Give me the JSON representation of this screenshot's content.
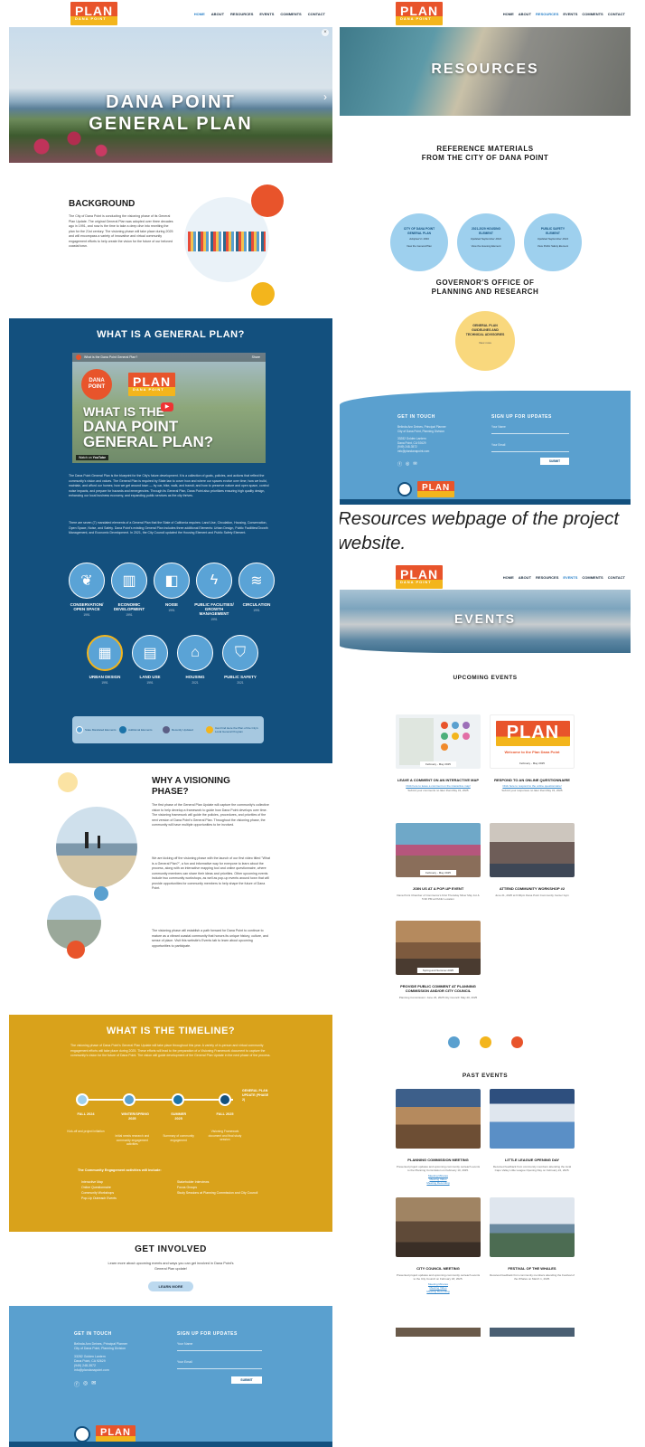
{
  "home": {
    "logo": {
      "main": "PLAN",
      "sub": "DANA POINT"
    },
    "nav": [
      "HOME",
      "ABOUT",
      "RESOURCES",
      "EVENTS",
      "COMMENTS",
      "CONTACT"
    ],
    "hero_line1": "DANA POINT",
    "hero_line2": "GENERAL PLAN",
    "background": {
      "title": "BACKGROUND",
      "body": "The City of Dana Point is conducting the visioning phase of its General Plan Update. The original General Plan was adopted over three decades ago in 1991, and now is the time to take a deep dive into rewriting the plan for the 21st century. The visioning phase will take place during 2025 and will encompass a variety of innovative and virtual community engagement efforts to help create the vision for the future of our beloved coastal town."
    },
    "general_plan": {
      "title": "WHAT IS A GENERAL PLAN?",
      "video_title": "What is the Dana Point General Plan?",
      "video_line1": "WHAT IS THE",
      "video_line2": "DANA POINT",
      "video_line3": "GENERAL PLAN?",
      "video_badge": "DANA POINT",
      "watch_on": "Watch on",
      "youtube": "YouTube",
      "share": "Share",
      "para1": "The Dana Point General Plan is the blueprint for the City's future development. It is a collection of goals, policies, and actions that reflect the community's vision and values. The General Plan is required by State law to cover how and where our spaces evolve over time; how we build, maintain, and afford our homes; how we get around town — by car, bike, walk, and transit; and how to preserve nature and open space, control noise impacts, and prepare for hazards and emergencies. Through its General Plan, Dana Point also prioritizes ensuring high quality design, enhancing our local business economy, and expanding public services as the city thrives.",
      "para2": "There are seven (7) mandated elements of a General Plan that the State of California requires: Land Use, Circulation, Housing, Conservation, Open Space, Noise, and Safety. Dana Point's existing General Plan includes three additional Elements: Urban Design, Public Facilities/Growth Management, and Economic Development. In 2021, the City Council updated the Housing Element and Public Safety Element.",
      "elements_row1": [
        {
          "label": "CONSERVATION/ OPEN SPACE",
          "year": "1991",
          "icon": "leaf-icon"
        },
        {
          "label": "ECONOMIC DEVELOPMENT",
          "year": "1991",
          "icon": "bar-chart-icon"
        },
        {
          "label": "NOISE",
          "year": "1991",
          "icon": "speaker-icon"
        },
        {
          "label": "PUBLIC FACILITIES/ GROWTH MANAGEMENT",
          "year": "1991",
          "icon": "lightning-icon"
        },
        {
          "label": "CIRCULATION",
          "year": "1991",
          "icon": "waves-icon"
        }
      ],
      "elements_row2": [
        {
          "label": "URBAN DESIGN",
          "year": "1991",
          "icon": "building-icon"
        },
        {
          "label": "LAND USE",
          "year": "1991",
          "icon": "grid-icon"
        },
        {
          "label": "HOUSING",
          "year": "2021",
          "icon": "house-icon"
        },
        {
          "label": "PUBLIC SAFETY",
          "year": "2021",
          "icon": "shield-icon"
        }
      ],
      "legend": [
        "State Mandated Elements",
        "Additional Elements",
        "Recently Updated",
        "Can Find Here the Plan of the City's Local General Program"
      ]
    },
    "visioning": {
      "title": "WHY A VISIONING PHASE?",
      "para1": "The first phase of the General Plan Update will capture the community's collective vision to help develop a framework to guide how Dana Point develops over time. The visioning framework will guide the policies, procedures, and priorities of the next version of Dana Point's General Plan. Throughout the visioning phase, the community will have multiple opportunities to be involved.",
      "para2": "We are kicking off the visioning phase with the launch of our first video titled \"What is a General Plan?\", a fun and informative way for everyone to learn about the process, along with an interactive mapping tool and online questionnaire, where community members can share their ideas and priorities. Other upcoming events include two community workshops, as well as pop-up events around town that will provide opportunities for community members to help shape the future of Dana Point.",
      "para3": "The visioning phase will establish a path forward for Dana Point to continue to mature as a vibrant coastal community that honors its unique history, culture, and sense of place. Visit this website's Events tab to learn about upcoming opportunities to participate."
    },
    "timeline": {
      "title": "WHAT IS THE TIMELINE?",
      "intro": "The visioning phase of Dana Point's General Plan Update will take place throughout this year. A variety of in-person and virtual community engagement efforts will take place during 2025. These efforts will lead to the preparation of a Visioning Framework document to capture the community's vision for the future of Dana Point. The vision will guide development of the General Plan Update in the next phase of the process.",
      "end_label": "GENERAL PLAN UPDATE (PHASE 2)",
      "steps": [
        {
          "season": "FALL 2024",
          "desc": "Kick-off and project initiation"
        },
        {
          "season": "WINTER/SPRING 2025",
          "desc": "Initial needs research and community engagement activities"
        },
        {
          "season": "SUMMER 2025",
          "desc": "Summary of community engagement"
        },
        {
          "season": "FALL 2025",
          "desc": "Visioning Framework document and final study session"
        }
      ],
      "activities_title": "The Community Engagement activities will include:",
      "activities_left": [
        "Interactive Map",
        "Online Questionnaire",
        "Community Workshops",
        "Pop-Up Outreach Events"
      ],
      "activities_right": [
        "Stakeholder Interviews",
        "Focus Groups",
        "Study Sessions at Planning Commission and City Council"
      ]
    },
    "get_involved": {
      "title": "GET INVOLVED",
      "body": "Learn more about upcoming events and ways you can get involved in Dana Point's General Plan update!",
      "button": "LEARN MORE"
    },
    "footer": {
      "touch_title": "GET IN TOUCH",
      "touch_lines": [
        "Belinda Ann Deines, Principal Planner",
        "City of Dana Point, Planning Division",
        "33282 Golden Lantern",
        "Dana Point, CA 92629",
        "(949) 248-3572",
        "info@plandanapoint.com"
      ],
      "signup_title": "SIGN UP FOR UPDATES",
      "name_placeholder": "Your Name",
      "email_placeholder": "Your Email",
      "submit": "SUBMIT"
    }
  },
  "resources": {
    "hero": "RESOURCES",
    "ref_title_1": "REFERENCE MATERIALS",
    "ref_title_2": "FROM THE CITY OF DANA POINT",
    "docs": [
      {
        "title": "CITY OF DANA POINT GENERAL PLAN",
        "sub": "Adopted in 1991",
        "link": "View the General Plan"
      },
      {
        "title": "2021-2029 HOUSING ELEMENT",
        "sub": "Updated September 2021",
        "link": "View the Housing Element"
      },
      {
        "title": "PUBLIC SAFETY ELEMENT",
        "sub": "Updated September 2021",
        "link": "View Public Safety Element"
      }
    ],
    "gov_title_1": "GOVERNOR'S OFFICE OF",
    "gov_title_2": "PLANNING AND RESEARCH",
    "gov_doc": {
      "title": "GENERAL PLAN GUIDELINES AND TECHNICAL ADVISORIES",
      "link": "View more"
    },
    "caption": "Resources webpage of the project website."
  },
  "events": {
    "hero": "EVENTS",
    "upcoming_title": "UPCOMING EVENTS",
    "upcoming": [
      {
        "date": "February - May 2025",
        "title": "LEAVE A COMMENT ON AN INTERACTIVE MAP",
        "link": "Click here to leave a comment on the interactive map!",
        "desc": "Submit your comments no later than May 31, 2025"
      },
      {
        "date": "February - May 2025",
        "title": "RESPOND TO AN ONLINE QUESTIONNAIRE",
        "link": "Click here to respond to the online questionnaire!",
        "desc": "Submit your responses no later than May 31, 2025",
        "banner": "Welcome to the Plan Dana Point"
      },
      {
        "date": "February - May 2025",
        "title": "JOIN US AT A POP-UP EVENT",
        "desc": "Dana Point Chamber of Commerce's First Thursday Mixer May 1st & 5:30 PM at Public Location"
      },
      {
        "date": "",
        "title": "ATTEND COMMUNITY WORKSHOP #2",
        "desc": "June 21, 2025 at 6:00pm Dana Point Community Center Gym"
      },
      {
        "date": "Spring and Summer 2025",
        "title": "PROVIDE PUBLIC COMMENT AT PLANNING COMMISSION AND/OR CITY COUNCIL",
        "desc": "Planning Commission: June 23, 2025 City Council: May 20, 2025"
      }
    ],
    "dots": [
      "#5aa0cf",
      "#f3b51c",
      "#e8542b"
    ],
    "past_title": "PAST EVENTS",
    "past": [
      {
        "title": "PLANNING COMMISSION MEETING",
        "desc": "Presented project updates and upcoming community outreach events to the Planning Commission on February 10, 2025.",
        "links": [
          "Meeting Minutes",
          "Meeting Video",
          "Meeting Recording"
        ]
      },
      {
        "title": "LITTLE LEAGUE OPENING DAY",
        "desc": "Received feedback from community members attending the local Capo Valley Little League Opening Day on February 22, 2025."
      },
      {
        "title": "CITY COUNCIL MEETING",
        "desc": "Presented project updates and upcoming community outreach events to the City Council on February 18, 2025.",
        "links": [
          "Meeting Minutes",
          "Meeting Video",
          "Meeting Recording"
        ]
      },
      {
        "title": "FESTIVAL OF THE WHALES",
        "desc": "Received feedback from community members attending the Festival of the Whales on March 1, 2025."
      }
    ]
  },
  "colors": {
    "navy": "#13507e",
    "blue": "#5aa0cf",
    "gold": "#d9a21b",
    "orange": "#e8542b",
    "yellow": "#f3b51c",
    "light_blue": "#9ed0ee"
  }
}
